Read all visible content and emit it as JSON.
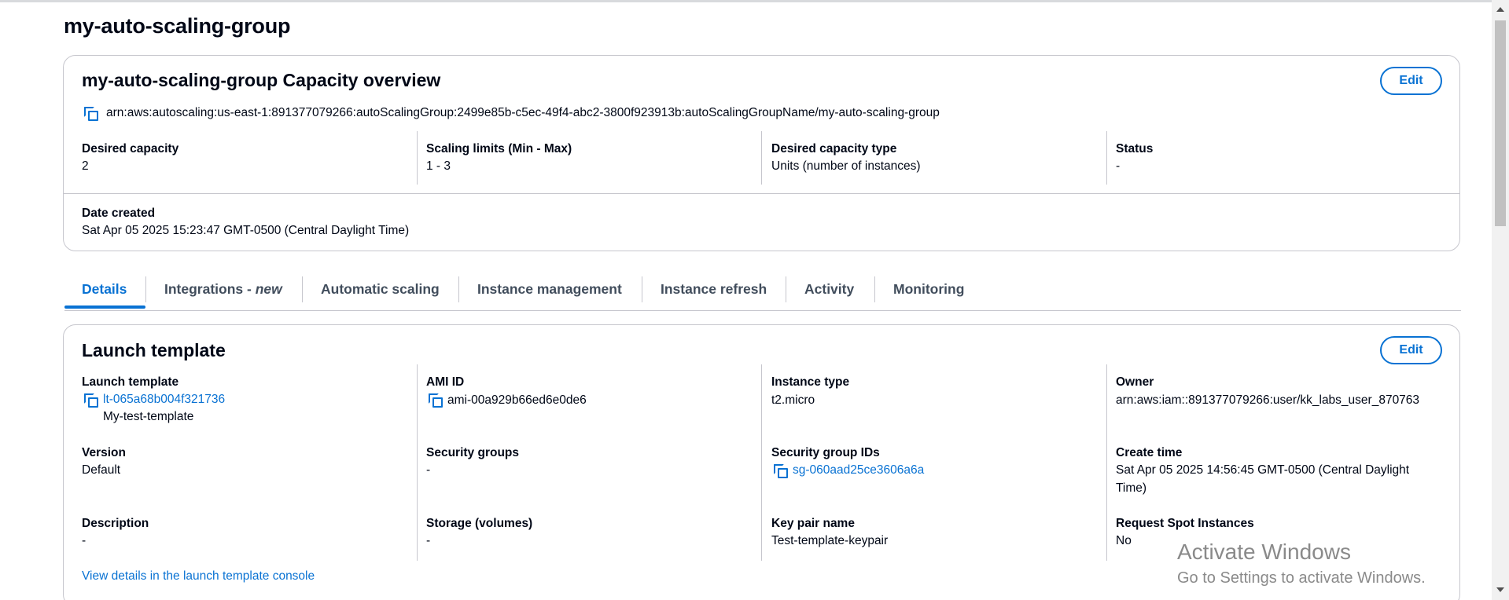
{
  "page_title": "my-auto-scaling-group",
  "capacity_overview": {
    "title": "my-auto-scaling-group Capacity overview",
    "edit_label": "Edit",
    "arn": "arn:aws:autoscaling:us-east-1:891377079266:autoScalingGroup:2499e85b-c5ec-49f4-abc2-3800f923913b:autoScalingGroupName/my-auto-scaling-group",
    "fields": [
      {
        "label": "Desired capacity",
        "value": "2"
      },
      {
        "label": "Scaling limits (Min - Max)",
        "value": "1 - 3"
      },
      {
        "label": "Desired capacity type",
        "value": "Units (number of instances)"
      },
      {
        "label": "Status",
        "value": "-"
      }
    ],
    "date_created": {
      "label": "Date created",
      "value": "Sat Apr 05 2025 15:23:47 GMT-0500 (Central Daylight Time)"
    }
  },
  "tabs": [
    {
      "label": "Details",
      "active": true
    },
    {
      "label": "Integrations - ",
      "suffix": "new"
    },
    {
      "label": "Automatic scaling"
    },
    {
      "label": "Instance management"
    },
    {
      "label": "Instance refresh"
    },
    {
      "label": "Activity"
    },
    {
      "label": "Monitoring"
    }
  ],
  "launch_template": {
    "title": "Launch template",
    "edit_label": "Edit",
    "launch_template": {
      "label": "Launch template",
      "id": "lt-065a68b004f321736",
      "name": "My-test-template"
    },
    "ami_id": {
      "label": "AMI ID",
      "value": "ami-00a929b66ed6e0de6"
    },
    "instance_type": {
      "label": "Instance type",
      "value": "t2.micro"
    },
    "owner": {
      "label": "Owner",
      "value": "arn:aws:iam::891377079266:user/kk_labs_user_870763"
    },
    "version": {
      "label": "Version",
      "value": "Default"
    },
    "security_groups": {
      "label": "Security groups",
      "value": "-"
    },
    "security_group_ids": {
      "label": "Security group IDs",
      "value": "sg-060aad25ce3606a6a"
    },
    "create_time": {
      "label": "Create time",
      "value_line1": "Sat Apr 05 2025 14:56:45 GMT-0500 (Central Daylight",
      "value_line2": "Time)"
    },
    "description": {
      "label": "Description",
      "value": "-"
    },
    "storage": {
      "label": "Storage (volumes)",
      "value": "-"
    },
    "key_pair": {
      "label": "Key pair name",
      "value": "Test-template-keypair"
    },
    "spot": {
      "label": "Request Spot Instances",
      "value": "No"
    },
    "view_details_link": "View details in the launch template console"
  },
  "watermark": {
    "title": "Activate Windows",
    "subtitle": "Go to Settings to activate Windows."
  },
  "colors": {
    "accent": "#0972d3",
    "text": "#000716",
    "border": "#c6c6cd"
  },
  "icons": [
    "copy-icon"
  ]
}
